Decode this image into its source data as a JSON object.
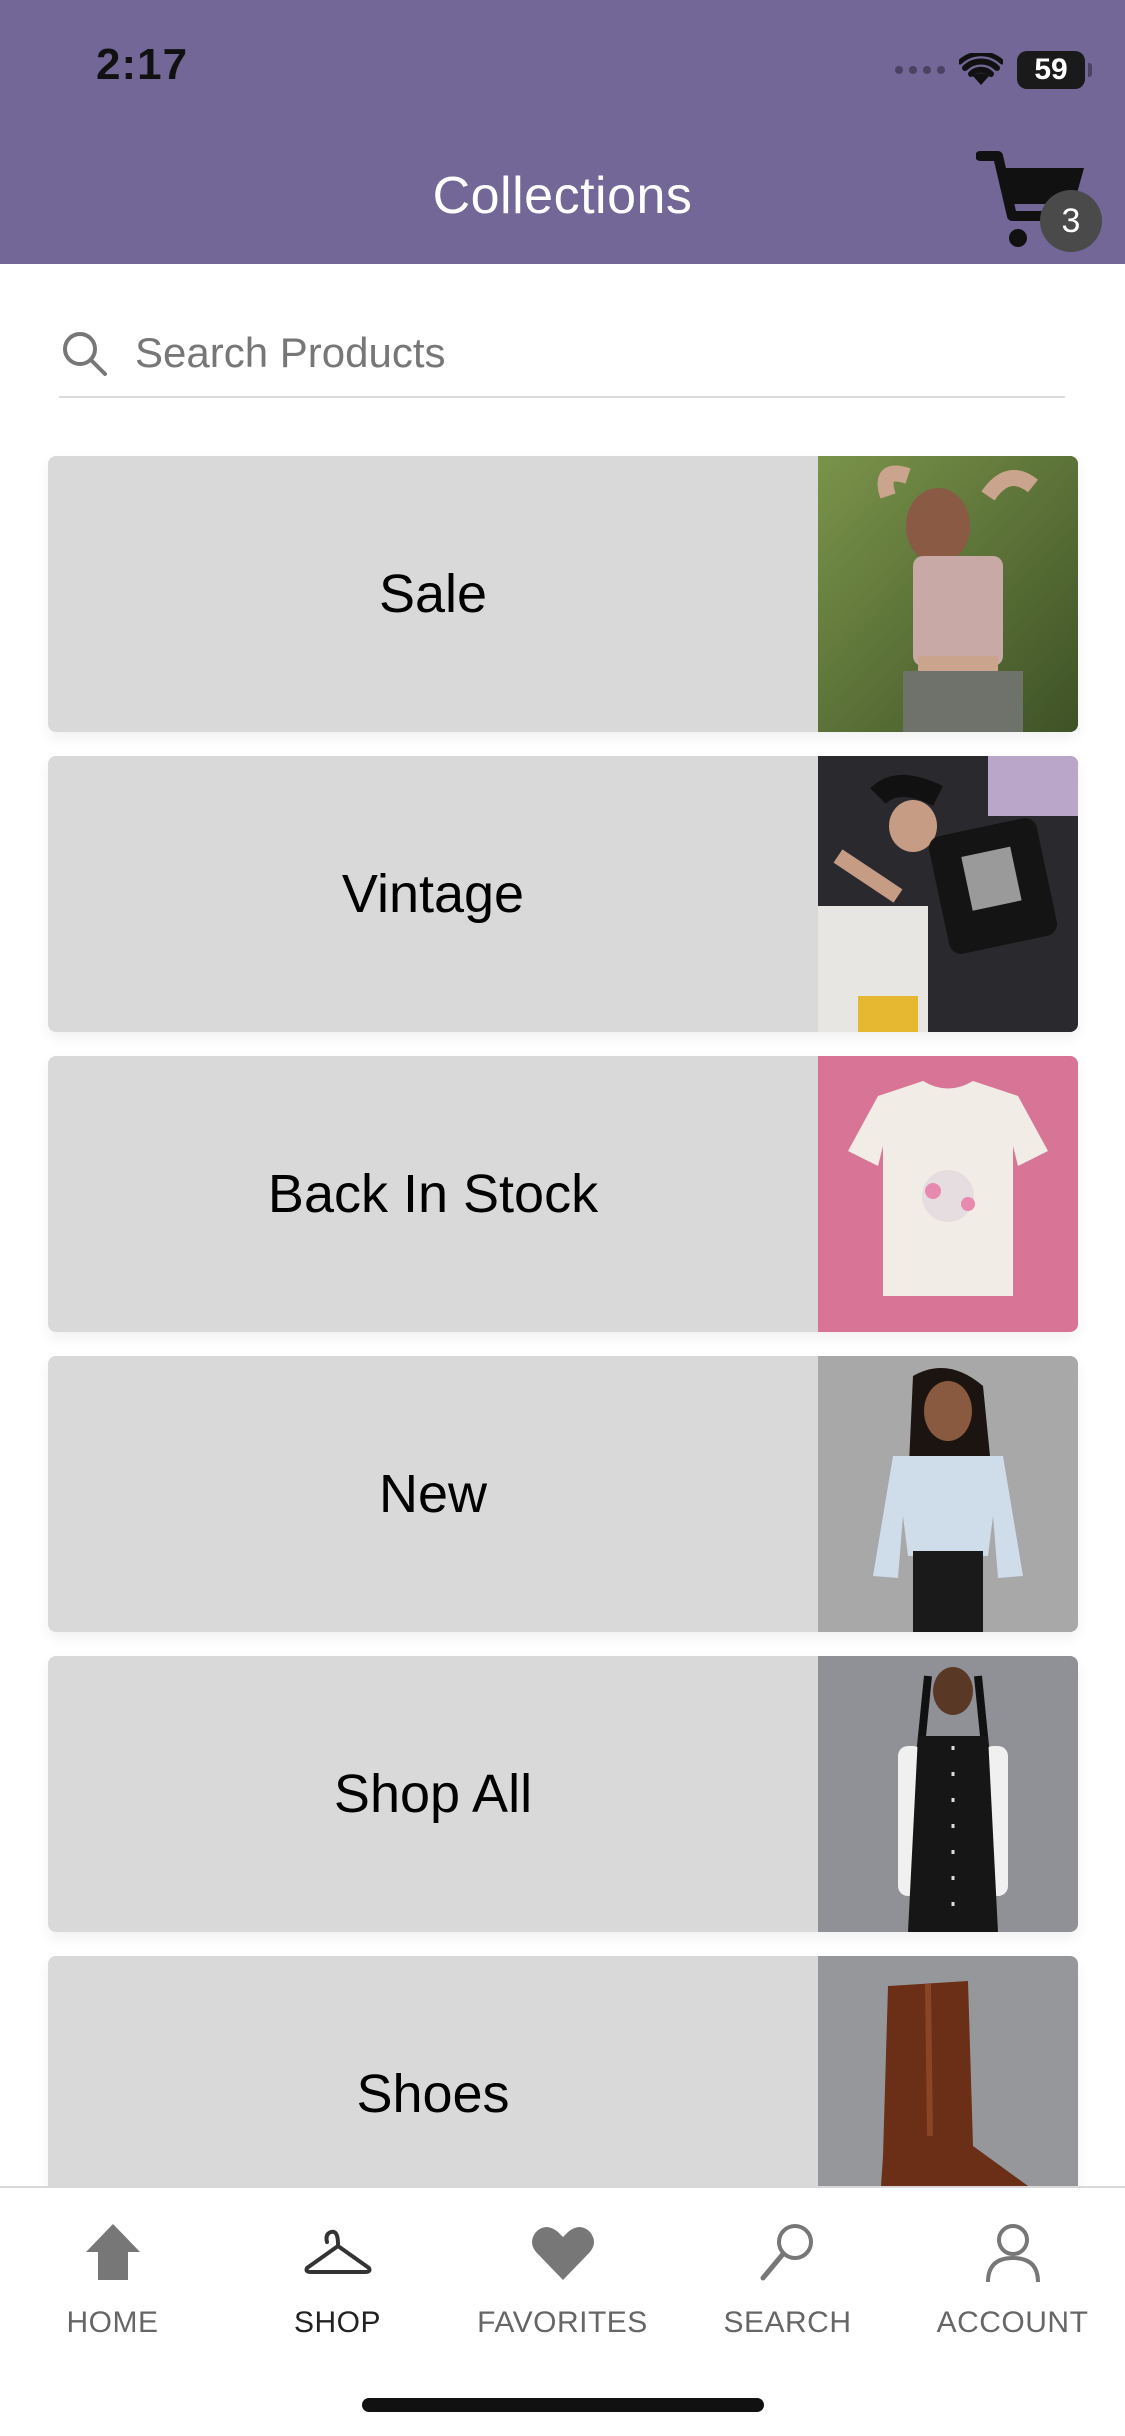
{
  "status_bar": {
    "time": "2:17",
    "battery": "59"
  },
  "header": {
    "title": "Collections",
    "cart_count": "3"
  },
  "search": {
    "placeholder": "Search Products"
  },
  "collections": [
    {
      "label": "Sale",
      "image": "woman-lying-on-grass"
    },
    {
      "label": "Vintage",
      "image": "woman-lying-on-clothes-pile"
    },
    {
      "label": "Back In Stock",
      "image": "white-tee-on-pink"
    },
    {
      "label": "New",
      "image": "woman-light-blue-sweater"
    },
    {
      "label": "Shop All",
      "image": "woman-black-vest-dress"
    },
    {
      "label": "Shoes",
      "image": "brown-platform-boot"
    }
  ],
  "bottom_nav": [
    {
      "label": "HOME",
      "icon": "home-icon"
    },
    {
      "label": "SHOP",
      "icon": "hanger-icon",
      "active": true
    },
    {
      "label": "FAVORITES",
      "icon": "heart-icon"
    },
    {
      "label": "SEARCH",
      "icon": "search-icon"
    },
    {
      "label": "ACCOUNT",
      "icon": "person-icon"
    }
  ],
  "colors": {
    "header": "#726797",
    "card": "#d9d9d9",
    "badge": "#4a4a4a"
  }
}
